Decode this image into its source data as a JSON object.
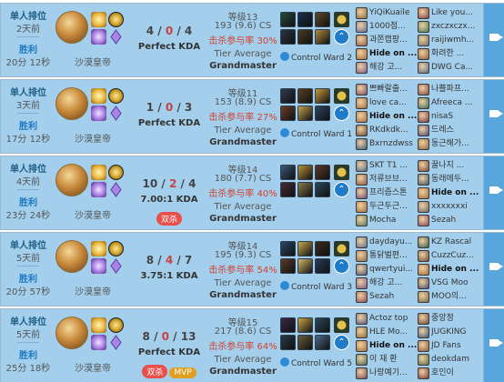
{
  "matches": [
    {
      "queue": "单人排位",
      "ago": "2天前",
      "result": "胜利",
      "duration": "20分 12秒",
      "champion": "沙漠皇帝",
      "kills": "4",
      "deaths": "0",
      "assists": "4",
      "ratio": "Perfect KDA",
      "badges": [],
      "level": "等级13",
      "cs": "193 (9.6) CS",
      "kp": "击杀参与率 30%",
      "tier_label": "Tier Average",
      "tier": "Grandmaster",
      "ward": "Control Ward 2",
      "items_top": [
        "#264b3b",
        "#1b2f4a",
        "#5d4a2d",
        "#c6983a",
        "#2d5a8a",
        "#6a3fa0"
      ],
      "items_bottom": [
        "#2b3648",
        "#4a3b1f",
        "#b08a3a",
        "#7b4b20",
        "#3b566e",
        "#a8843a"
      ],
      "players": [
        {
          "name": "YiQiKuaile",
          "color": "#8d6c3d"
        },
        {
          "name": "1000점...",
          "color": "#5b6f9a"
        },
        {
          "name": "과쫀캡팡...",
          "color": "#955b46"
        },
        {
          "name": "Hide on ...",
          "color": "#a56d3a",
          "me": true
        },
        {
          "name": "해강 고...",
          "color": "#7a5a8a"
        },
        {
          "name": "Like you...",
          "color": "#7d3e3e"
        },
        {
          "name": "zxczxczx...",
          "color": "#4f7a5a"
        },
        {
          "name": "raijiwmh...",
          "color": "#6d6d6d"
        },
        {
          "name": "화려한 ...",
          "color": "#8a5d3a"
        },
        {
          "name": "DWG Ca...",
          "color": "#5d6a8a"
        }
      ]
    },
    {
      "queue": "单人排位",
      "ago": "3天前",
      "result": "胜利",
      "duration": "17分 12秒",
      "champion": "沙漠皇帝",
      "kills": "1",
      "deaths": "0",
      "assists": "3",
      "ratio": "Perfect KDA",
      "badges": [],
      "level": "等级11",
      "cs": "153 (8.9) CS",
      "kp": "击杀参与率 27%",
      "tier_label": "Tier Average",
      "tier": "Grandmaster",
      "ward": "Control Ward 1",
      "items_top": [
        "#2f3c52",
        "#5a4020",
        "#c59a3c",
        "#1d4a6a",
        "#3a2f20",
        "#8b6a2b"
      ],
      "items_bottom": [
        "#6a3f2a",
        "#c3a052",
        "#2c4660",
        "#334455",
        "#596a3a",
        "#7a6a55"
      ],
      "players": [
        {
          "name": "쁘빠랄출...",
          "color": "#7d4e6a"
        },
        {
          "name": "love ca...",
          "color": "#a56b3d"
        },
        {
          "name": "Hide on ...",
          "color": "#a56d3a",
          "me": true
        },
        {
          "name": "RKdkdk...",
          "color": "#6b4a3a"
        },
        {
          "name": "Bxrnzdwss",
          "color": "#3e5a7a"
        },
        {
          "name": "나쁠파프...",
          "color": "#8a4a4a"
        },
        {
          "name": "Afreeca ...",
          "color": "#3a6a5a"
        },
        {
          "name": "nisaS",
          "color": "#7a3a4a"
        },
        {
          "name": "드레스",
          "color": "#4a4a7a"
        },
        {
          "name": "동근해가...",
          "color": "#8a6a3a"
        }
      ]
    },
    {
      "queue": "单人排位",
      "ago": "4天前",
      "result": "胜利",
      "duration": "23分 24秒",
      "champion": "沙漠皇帝",
      "kills": "10",
      "deaths": "2",
      "assists": "4",
      "ratio": "7.00:1 KDA",
      "badges": [
        {
          "text": "双杀",
          "kind": "multi"
        }
      ],
      "level": "等级14",
      "cs": "180 (7.7) CS",
      "kp": "击杀参与率 40%",
      "tier_label": "Tier Average",
      "tier": "Grandmaster",
      "ward": "",
      "items_top": [
        "#3a5a7a",
        "#b8913a",
        "#5a3a2a",
        "#c8a64a",
        "#2a3a4a",
        "#6a5a3a"
      ],
      "items_bottom": [
        "#4a2a3a",
        "#8a7a4a",
        "#2a4a5a",
        "#a07b3b",
        "#3a3a3a",
        "#5a6a7a"
      ],
      "players": [
        {
          "name": "SKT T1 ...",
          "color": "#4a6a8a"
        },
        {
          "name": "저류브브...",
          "color": "#8a5a4a"
        },
        {
          "name": "프리즘스톤",
          "color": "#6a4a7a"
        },
        {
          "name": "두근두근...",
          "color": "#a56d3a"
        },
        {
          "name": "Mocha",
          "color": "#5a7a5a"
        },
        {
          "name": "꿀나지 ...",
          "color": "#7a4a3a"
        },
        {
          "name": "동래메두...",
          "color": "#3a5a6a"
        },
        {
          "name": "Hide on ...",
          "color": "#a56d3a",
          "me": true
        },
        {
          "name": "xxxxxxxi",
          "color": "#6a6a6a"
        },
        {
          "name": "Sezah",
          "color": "#8a4a5a"
        }
      ]
    },
    {
      "queue": "单人排位",
      "ago": "5天前",
      "result": "胜利",
      "duration": "20分 57秒",
      "champion": "沙漠皇帝",
      "kills": "8",
      "deaths": "4",
      "assists": "7",
      "ratio": "3.75:1 KDA",
      "badges": [],
      "level": "等级14",
      "cs": "195 (9.3) CS",
      "kp": "击杀参与率 54%",
      "tier_label": "Tier Average",
      "tier": "Grandmaster",
      "ward": "Control Ward 3",
      "items_top": [
        "#2a4a6a",
        "#c8a84a",
        "#3a2a1a",
        "#7a5a3a",
        "#4a5a2a",
        "#b0893c"
      ],
      "items_bottom": [
        "#5a3a2a",
        "#d3b66a",
        "#2a3a5a",
        "#6a4a2a",
        "#3a4a3a",
        "#9a7a4a"
      ],
      "players": [
        {
          "name": "daydayu...",
          "color": "#5a6a8a"
        },
        {
          "name": "통닭벌편...",
          "color": "#8a6a4a"
        },
        {
          "name": "qwertyui...",
          "color": "#4a5a7a"
        },
        {
          "name": "해강 고...",
          "color": "#7a5a8a"
        },
        {
          "name": "Sezah",
          "color": "#8a4a5a"
        },
        {
          "name": "KZ Rascal",
          "color": "#3a5a4a"
        },
        {
          "name": "CuzzCuz...",
          "color": "#6a4a3a"
        },
        {
          "name": "Hide on ...",
          "color": "#a56d3a",
          "me": true
        },
        {
          "name": "VSG Moo",
          "color": "#4a4a6a"
        },
        {
          "name": "MOO의...",
          "color": "#7a6a4a"
        }
      ]
    },
    {
      "queue": "单人排位",
      "ago": "5天前",
      "result": "胜利",
      "duration": "25分 18秒",
      "champion": "沙漠皇帝",
      "kills": "8",
      "deaths": "0",
      "assists": "13",
      "ratio": "Perfect KDA",
      "badges": [
        {
          "text": "双杀",
          "kind": "multi"
        },
        {
          "text": "MVP",
          "kind": "mvp"
        }
      ],
      "level": "等级15",
      "cs": "217 (8.6) CS",
      "kp": "击杀参与率 64%",
      "tier_label": "Tier Average",
      "tier": "Grandmaster",
      "ward": "Control Ward 5",
      "items_top": [
        "#3a2a4a",
        "#c8a44a",
        "#2a4a5a",
        "#8a6a3a",
        "#5a3a2a",
        "#b09040"
      ],
      "items_bottom": [
        "#2a3a4a",
        "#6a5a3a",
        "#4a6a8a",
        "#a8884a",
        "#3a3a2a",
        "#7a5a4a"
      ],
      "players": [
        {
          "name": "Actoz top",
          "color": "#5a5a7a"
        },
        {
          "name": "HLE Mo...",
          "color": "#8a6a3a"
        },
        {
          "name": "Hide on ...",
          "color": "#a56d3a",
          "me": true
        },
        {
          "name": "이 재 환",
          "color": "#4a6a5a"
        },
        {
          "name": "나랑예기...",
          "color": "#7a4a5a"
        },
        {
          "name": "중앙정",
          "color": "#6a4a3a"
        },
        {
          "name": "JUGKING",
          "color": "#3a5a7a"
        },
        {
          "name": "JD Fans",
          "color": "#8a5a3a"
        },
        {
          "name": "deokdam",
          "color": "#5a6a4a"
        },
        {
          "name": "호인이",
          "color": "#7a3a3a"
        }
      ]
    }
  ]
}
